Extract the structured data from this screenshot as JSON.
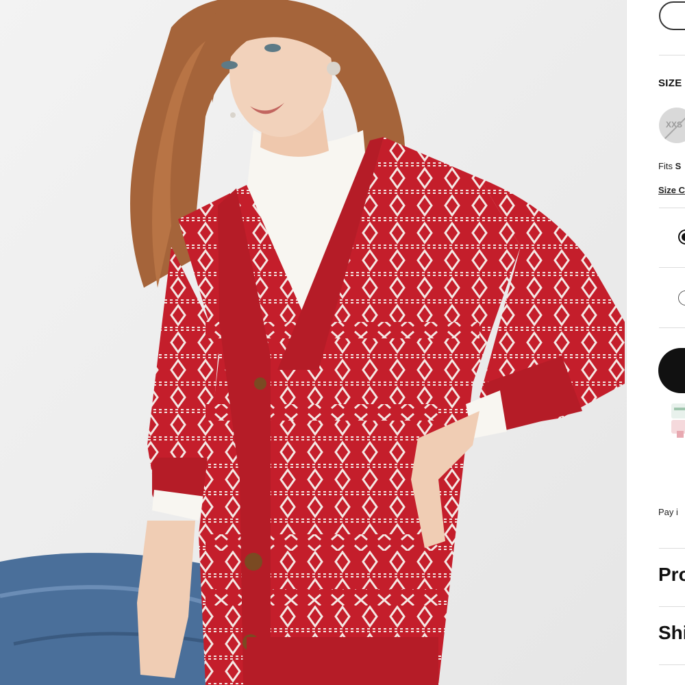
{
  "product_image": {
    "alt_subject": "red fair isle cardigan"
  },
  "panel": {
    "size_heading": "SIZE",
    "size_options": [
      {
        "label": "XXS",
        "available": false
      }
    ],
    "fits_prefix": "Fits",
    "fits_value": "S",
    "size_guide_label": "Size C",
    "pay_text": "Pay i",
    "sections": [
      {
        "title": "Pro"
      },
      {
        "title": "Shi"
      }
    ]
  },
  "colors": {
    "cardigan_red": "#c41e2b",
    "button_dark": "#111111",
    "divider": "#dcdcdc"
  }
}
